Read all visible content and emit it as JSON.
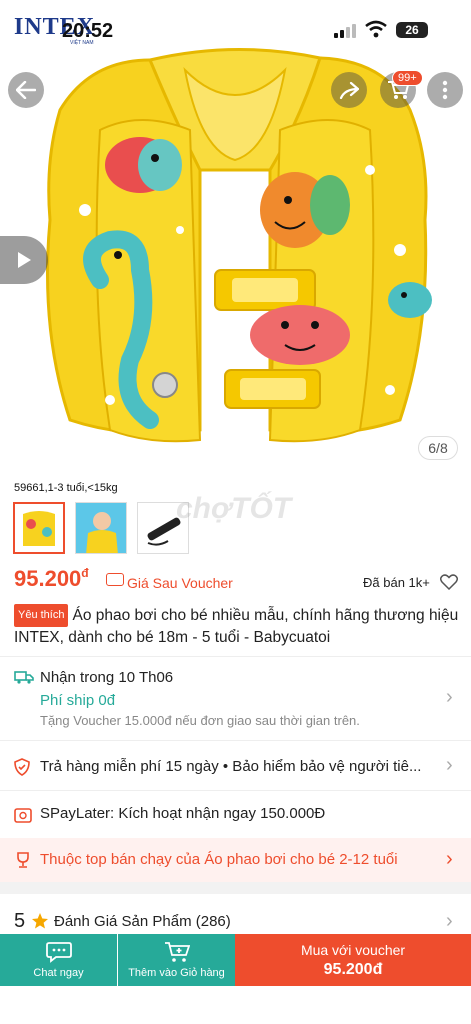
{
  "status_bar": {
    "brand": "INTEX",
    "brand_sub": "VIỆT NAM",
    "time": "20:52",
    "battery": "26"
  },
  "hero": {
    "page_indicator": "6/8",
    "cart_badge": "99+"
  },
  "variations": {
    "caption": "59661,1-3 tuổi,<15kg"
  },
  "watermark": "chợTỐT",
  "price": {
    "value": "95.200",
    "currency": "đ",
    "after_voucher_label": "Giá Sau Voucher",
    "sold": "Đã bán 1k+"
  },
  "product": {
    "badge": "Yêu thích",
    "title": "Áo phao bơi cho bé nhiều mẫu, chính hãng thương hiệu INTEX, dành cho bé 18m - 5 tuổi - Babycuatoi"
  },
  "shipping": {
    "title": "Nhận trong 10 Th06",
    "fee": "Phí ship 0đ",
    "note": "Tặng Voucher 15.000đ nếu đơn giao sau thời gian trên."
  },
  "returns": {
    "text": "Trả hàng miễn phí 15 ngày  •  Bảo hiểm bảo vệ người tiê..."
  },
  "spaylater": {
    "text": "SPayLater: Kích hoạt nhận ngay 150.000Đ"
  },
  "ranking": {
    "text": "Thuộc top bán chạy của Áo phao bơi cho bé 2-12 tuổi"
  },
  "rating": {
    "score": "5",
    "title": "Đánh Giá Sản Phẩm (286)"
  },
  "bottom_bar": {
    "chat_label": "Chat ngay",
    "cart_label": "Thêm vào Giỏ hàng",
    "buy_line1": "Mua với voucher",
    "buy_line2": "95.200đ"
  },
  "colors": {
    "accent": "#ee4d2d",
    "teal": "#26aa99",
    "vest_yellow": "#f7d21f"
  }
}
